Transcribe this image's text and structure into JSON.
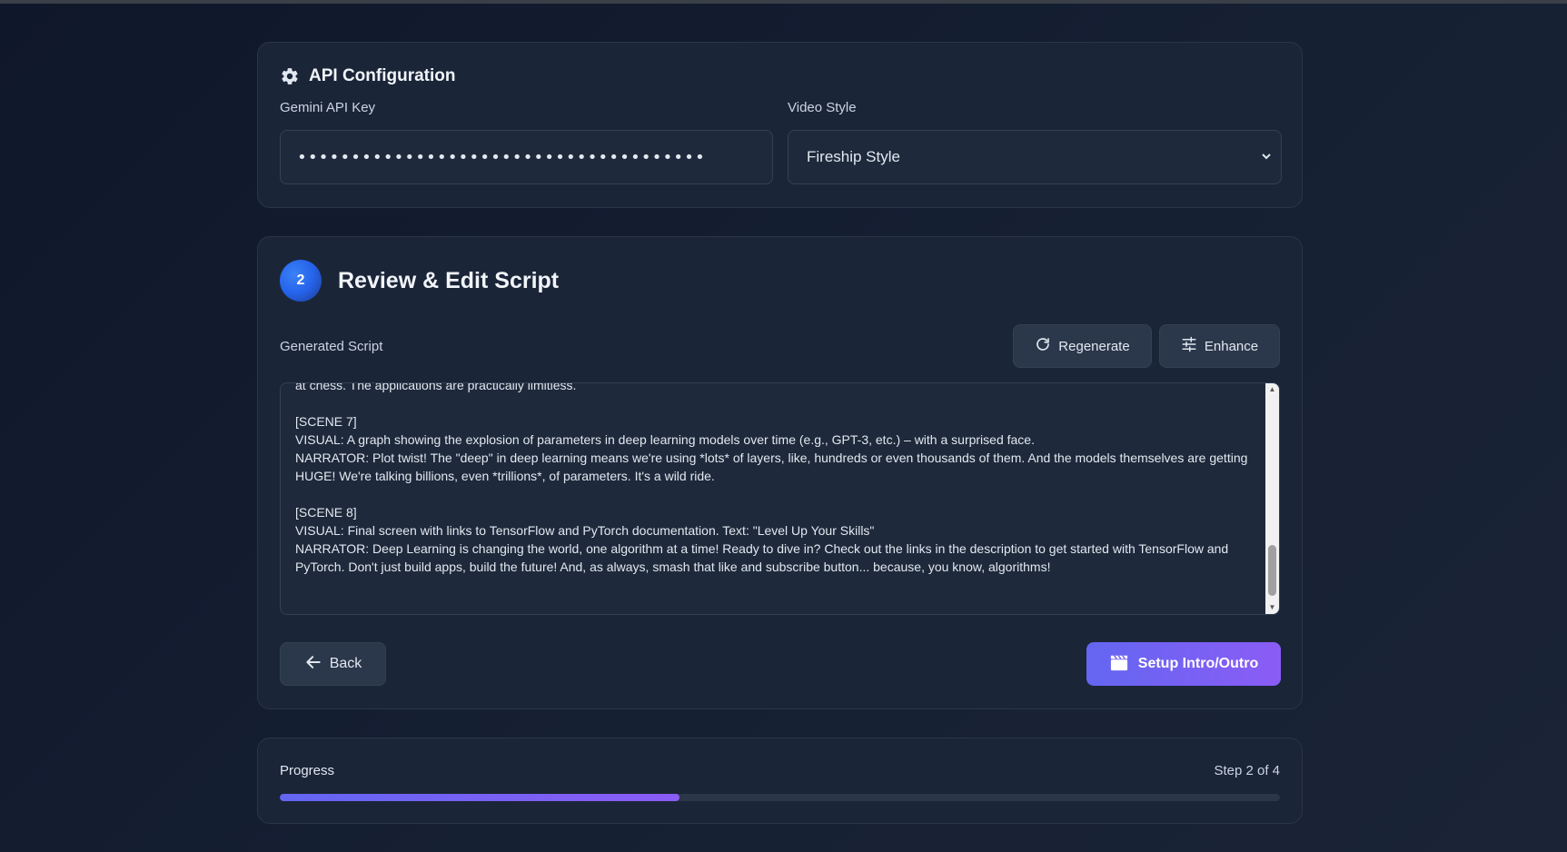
{
  "api_config": {
    "title": "API Configuration",
    "gemini_label": "Gemini API Key",
    "gemini_value": "••••••••••••••••••••••••••••••••••••••",
    "style_label": "Video Style",
    "style_selected": "Fireship Style"
  },
  "review": {
    "step_number": "2",
    "title": "Review & Edit Script",
    "script_label": "Generated Script",
    "regenerate_label": "Regenerate",
    "enhance_label": "Enhance",
    "script_text": "at chess. The applications are practically limitless.\n\n[SCENE 7]\nVISUAL: A graph showing the explosion of parameters in deep learning models over time (e.g., GPT-3, etc.) – with a surprised face.\nNARRATOR: Plot twist! The \"deep\" in deep learning means we're using *lots* of layers, like, hundreds or even thousands of them. And the models themselves are getting HUGE! We're talking billions, even *trillions*, of parameters. It's a wild ride.\n\n[SCENE 8]\nVISUAL: Final screen with links to TensorFlow and PyTorch documentation. Text: \"Level Up Your Skills\"\nNARRATOR: Deep Learning is changing the world, one algorithm at a time! Ready to dive in? Check out the links in the description to get started with TensorFlow and PyTorch. Don't just build apps, build the future! And, as always, smash that like and subscribe button... because, you know, algorithms!",
    "back_label": "Back",
    "setup_label": "Setup Intro/Outro"
  },
  "progress": {
    "label": "Progress",
    "step_text": "Step 2 of 4",
    "fraction": 0.4
  },
  "colors": {
    "accent_start": "#6366f1",
    "accent_end": "#8b5cf6",
    "background": "#0f172a",
    "card": "#1b2538"
  },
  "icons": [
    "gear-icon",
    "refresh-icon",
    "sliders-icon",
    "arrow-left-icon",
    "clapperboard-icon",
    "chevron-down-icon"
  ]
}
